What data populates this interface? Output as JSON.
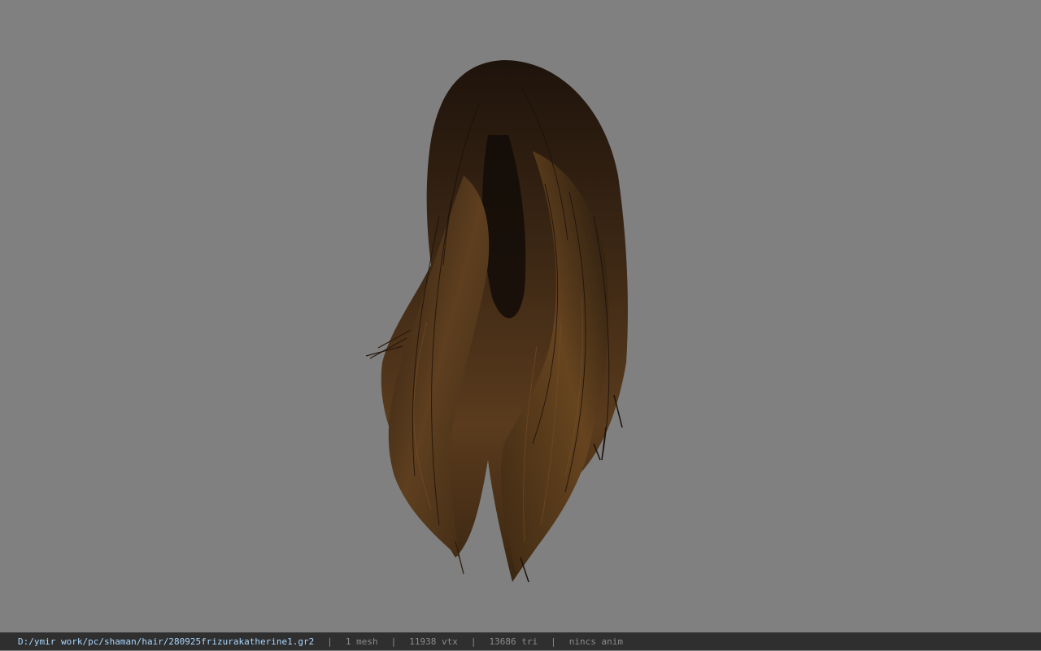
{
  "viewport": {
    "background_color": "#808080",
    "model_name": "hair mesh"
  },
  "status_bar": {
    "file_path": "D:/ymir work/pc/shaman/hair/280925frizurakatherine1.gr2",
    "separator": "|",
    "mesh_count": "1 mesh",
    "vertex_count": "11938 vtx",
    "triangle_count": "13686 tri",
    "animation_status": "nincs anim",
    "path_color": "#aad7ff",
    "text_color": "#8c8c8c",
    "background_color": "#2f2f2f"
  }
}
